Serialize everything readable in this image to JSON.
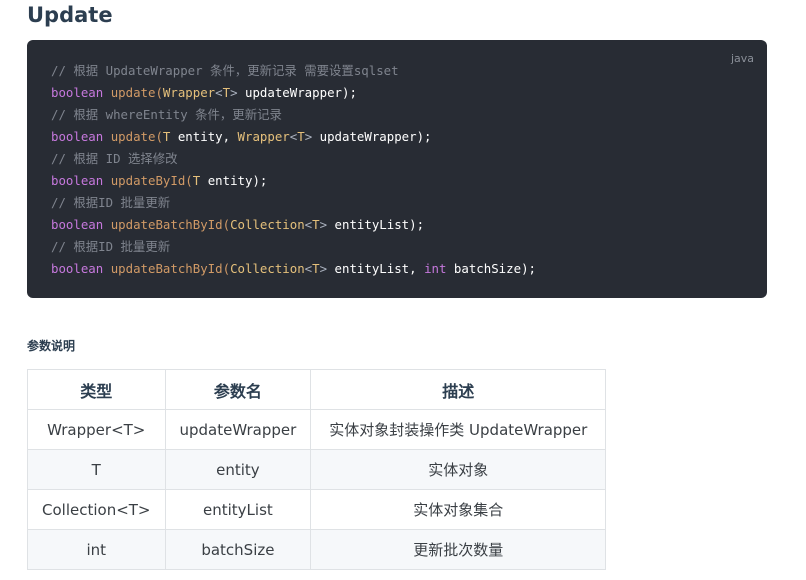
{
  "section": {
    "title": "Update"
  },
  "code_block": {
    "language": "java",
    "lines": [
      {
        "type": "comment",
        "text": "// 根据 UpdateWrapper 条件，更新记录 需要设置sqlset"
      },
      {
        "type": "code",
        "keyword": "boolean",
        "method": "update",
        "open": "(",
        "params": [
          {
            "type": "Wrapper",
            "generic": "T",
            "name": "updateWrapper"
          }
        ],
        "close": ");"
      },
      {
        "type": "comment",
        "text": "// 根据 whereEntity 条件，更新记录"
      },
      {
        "type": "code",
        "keyword": "boolean",
        "method": "update",
        "open": "(",
        "params": [
          {
            "type": "T",
            "name": "entity"
          },
          {
            "type": "Wrapper",
            "generic": "T",
            "name": "updateWrapper"
          }
        ],
        "close": ");"
      },
      {
        "type": "comment",
        "text": "// 根据 ID 选择修改"
      },
      {
        "type": "code",
        "keyword": "boolean",
        "method": "updateById",
        "open": "(",
        "params": [
          {
            "type": "T",
            "name": "entity"
          }
        ],
        "close": ");"
      },
      {
        "type": "comment",
        "text": "// 根据ID 批量更新"
      },
      {
        "type": "code",
        "keyword": "boolean",
        "method": "updateBatchById",
        "open": "(",
        "params": [
          {
            "type": "Collection",
            "generic": "T",
            "name": "entityList"
          }
        ],
        "close": ");"
      },
      {
        "type": "comment",
        "text": "// 根据ID 批量更新"
      },
      {
        "type": "code",
        "keyword": "boolean",
        "method": "updateBatchById",
        "open": "(",
        "params": [
          {
            "type": "Collection",
            "generic": "T",
            "name": "entityList"
          },
          {
            "type": "int",
            "name": "batchSize",
            "primitive": true
          }
        ],
        "close": ");"
      }
    ]
  },
  "params_section": {
    "heading": "参数说明",
    "headers": [
      "类型",
      "参数名",
      "描述"
    ],
    "rows": [
      [
        "Wrapper<T>",
        "updateWrapper",
        "实体对象封装操作类 UpdateWrapper"
      ],
      [
        "T",
        "entity",
        "实体对象"
      ],
      [
        "Collection<T>",
        "entityList",
        "实体对象集合"
      ],
      [
        "int",
        "batchSize",
        "更新批次数量"
      ]
    ]
  },
  "colors": {
    "code_bg": "#282c34",
    "keyword": "#c678dd",
    "method": "#d19a66",
    "type": "#e5c07b",
    "comment": "#7f848e",
    "alt_row": "#f6f8fa"
  }
}
